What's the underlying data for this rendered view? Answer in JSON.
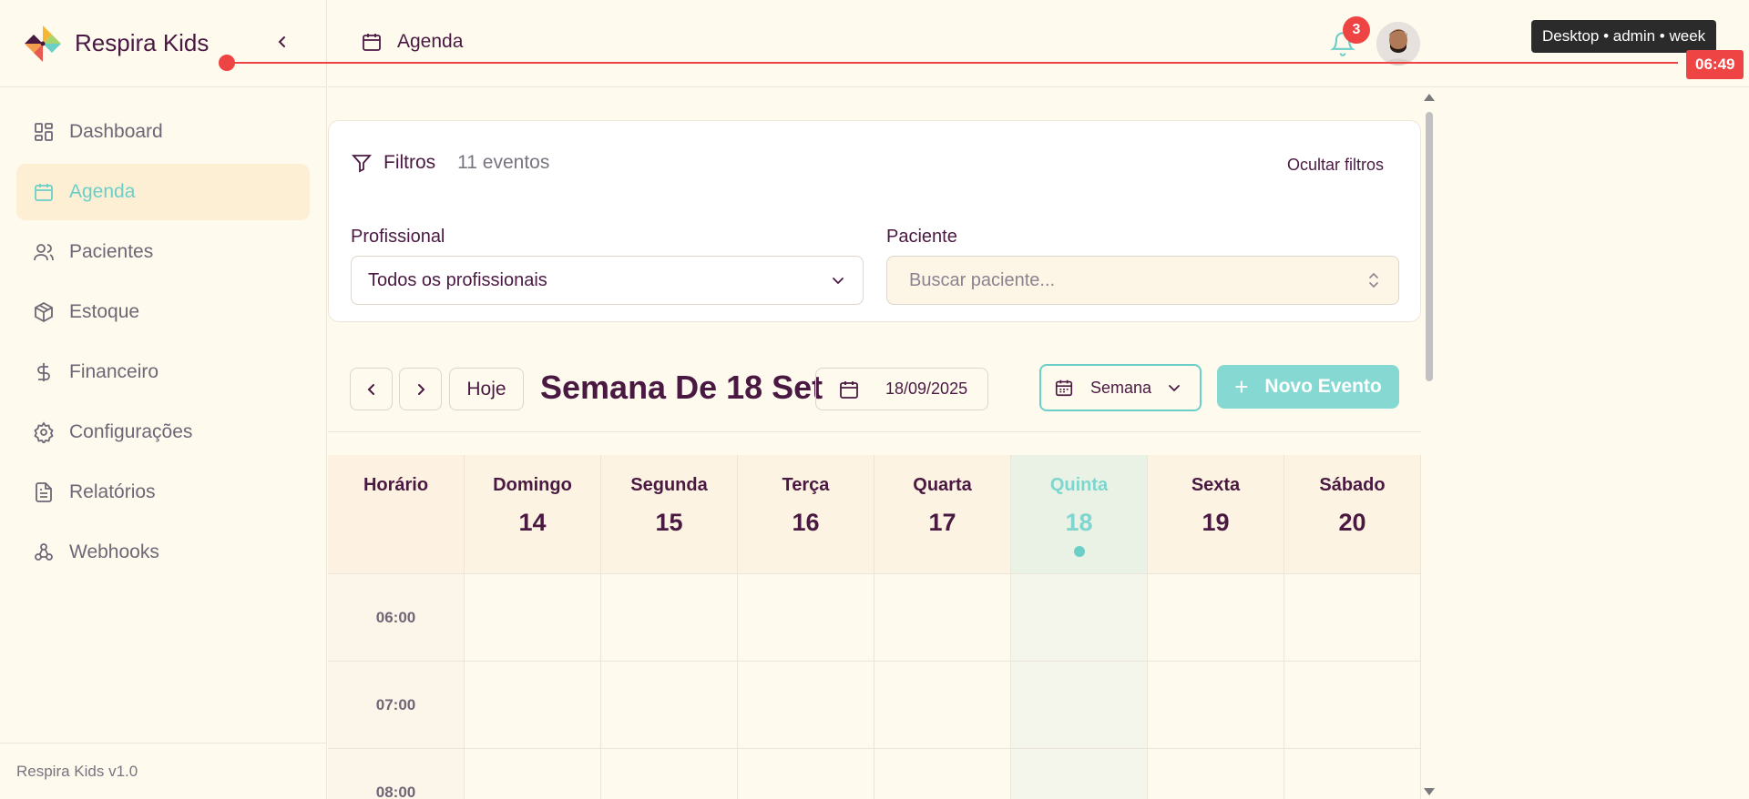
{
  "brand": {
    "name": "Respira Kids",
    "version": "Respira Kids v1.0"
  },
  "sidebar": {
    "items": [
      {
        "label": "Dashboard",
        "icon": "dashboard-icon",
        "active": false
      },
      {
        "label": "Agenda",
        "icon": "calendar-icon",
        "active": true
      },
      {
        "label": "Pacientes",
        "icon": "users-icon",
        "active": false
      },
      {
        "label": "Estoque",
        "icon": "box-icon",
        "active": false
      },
      {
        "label": "Financeiro",
        "icon": "dollar-icon",
        "active": false
      },
      {
        "label": "Configurações",
        "icon": "gear-icon",
        "active": false
      },
      {
        "label": "Relatórios",
        "icon": "file-icon",
        "active": false
      },
      {
        "label": "Webhooks",
        "icon": "webhook-icon",
        "active": false
      }
    ]
  },
  "header": {
    "title": "Agenda",
    "notifications": "3",
    "viewport_badge": "Desktop • admin • week",
    "current_time": "06:49"
  },
  "filters": {
    "title": "Filtros",
    "count": "11 eventos",
    "hide_label": "Ocultar filtros",
    "professional_label": "Profissional",
    "professional_value": "Todos os profissionais",
    "patient_label": "Paciente",
    "patient_placeholder": "Buscar paciente..."
  },
  "toolbar": {
    "today": "Hoje",
    "week_title": "Semana De 18 Set",
    "date": "18/09/2025",
    "view": "Semana",
    "new_event": "Novo Evento"
  },
  "calendar": {
    "time_header": "Horário",
    "days": [
      {
        "name": "Domingo",
        "num": "14"
      },
      {
        "name": "Segunda",
        "num": "15"
      },
      {
        "name": "Terça",
        "num": "16"
      },
      {
        "name": "Quarta",
        "num": "17"
      },
      {
        "name": "Quinta",
        "num": "18",
        "today": true
      },
      {
        "name": "Sexta",
        "num": "19"
      },
      {
        "name": "Sábado",
        "num": "20"
      }
    ],
    "hours": [
      "06:00",
      "07:00",
      "08:00"
    ]
  },
  "colors": {
    "accent": "#6ccfc7",
    "brand": "#4a1942",
    "alert": "#ef4444",
    "background": "#fefaee"
  }
}
